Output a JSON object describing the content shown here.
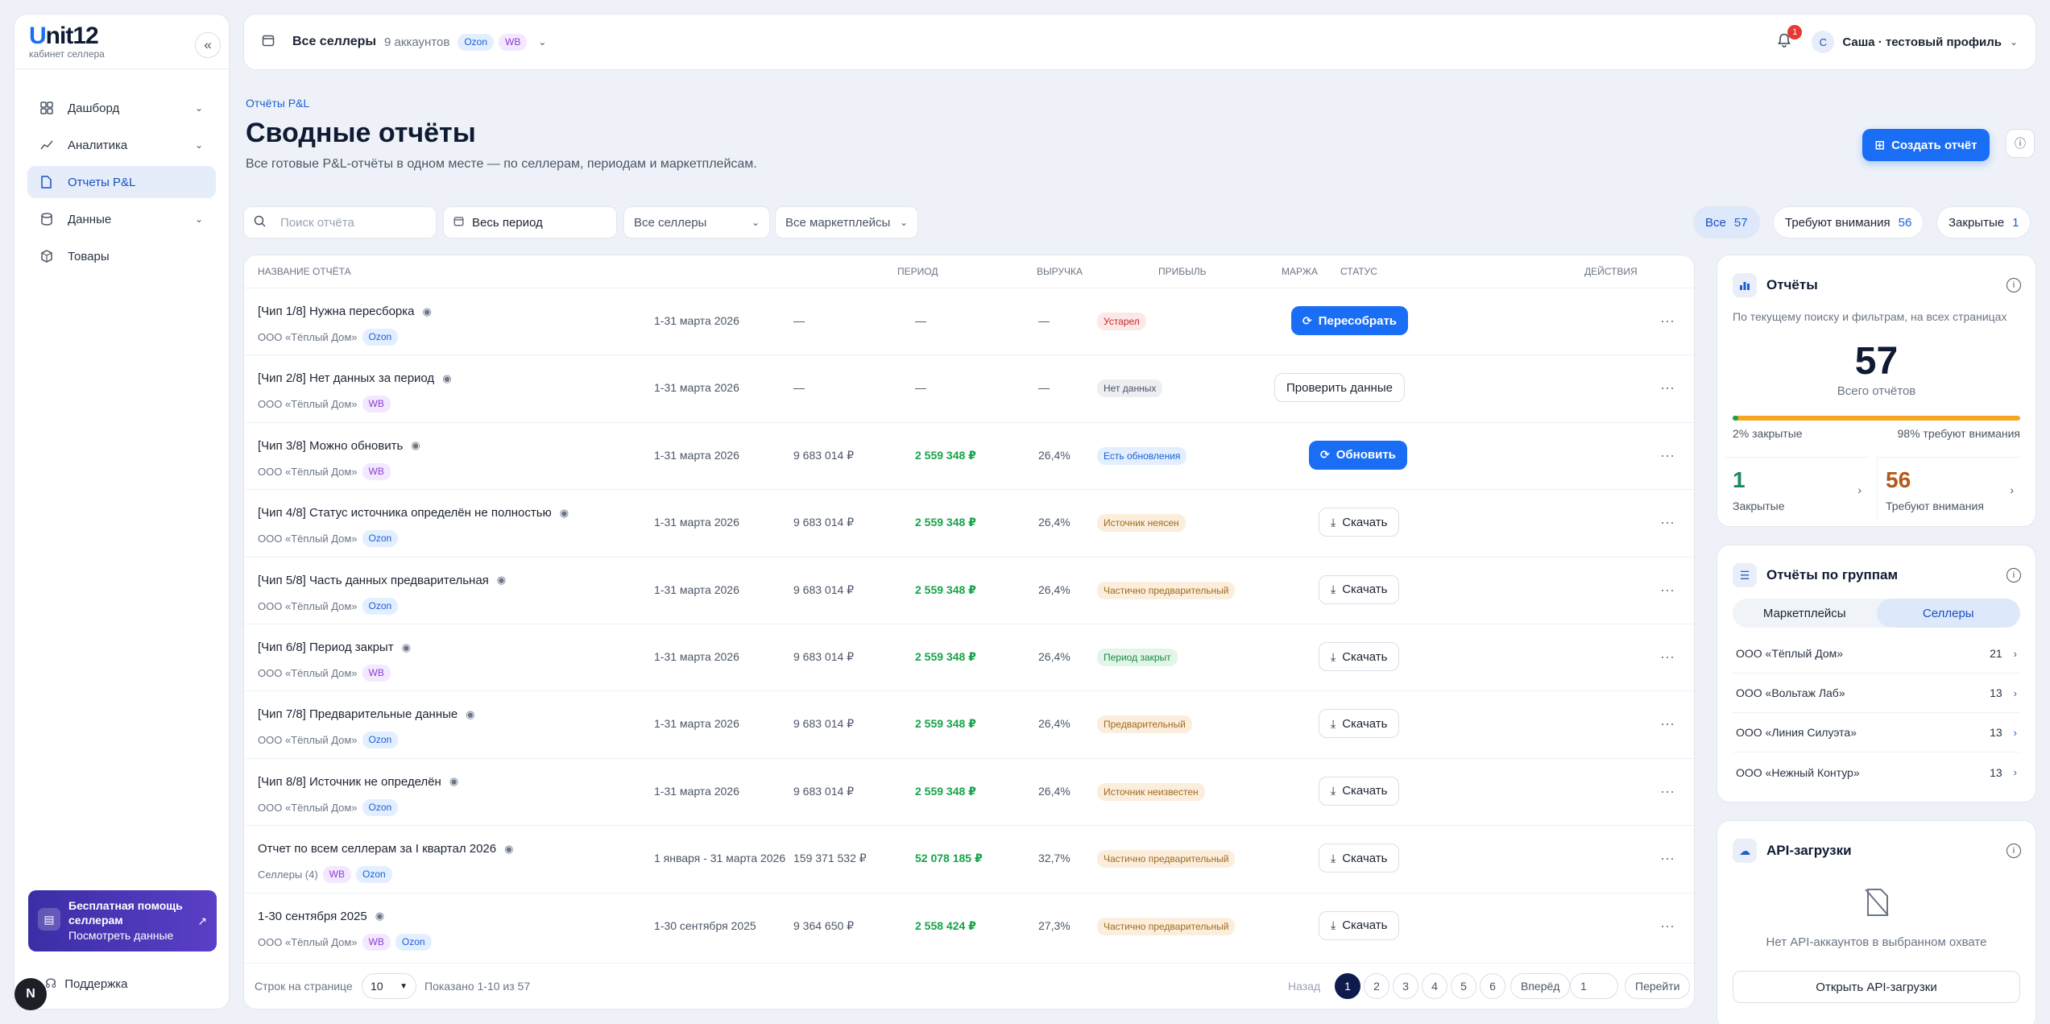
{
  "sidebar": {
    "brand_prefix": "U",
    "brand_rest": "nit12",
    "brand_sub": "кабинет селлера",
    "collapse_icon": "chevrons-left-icon",
    "items": [
      {
        "label": "Дашборд",
        "icon": "grid-icon",
        "has_chevron": true
      },
      {
        "label": "Аналитика",
        "icon": "chart-line-icon",
        "has_chevron": true
      },
      {
        "label": "Отчеты P&L",
        "icon": "file-icon",
        "active": true
      },
      {
        "label": "Данные",
        "icon": "database-icon",
        "has_chevron": true
      },
      {
        "label": "Товары",
        "icon": "box-icon"
      }
    ],
    "promo_title": "Бесплатная помощь селлерам",
    "promo_link": "Посмотреть данные",
    "support": "Поддержка",
    "avatar_letter": "N"
  },
  "header": {
    "sellers_label": "Все селлеры",
    "accounts_count": "9 аккаунтов",
    "tag_ozon": "Ozon",
    "tag_wb": "WB",
    "notification_count": "1",
    "user_initial": "С",
    "user_name": "Саша · тестовый профиль"
  },
  "page": {
    "breadcrumb": "Отчёты P&L",
    "title": "Сводные отчёты",
    "subtitle": "Все готовые P&L-отчёты в одном месте — по селлерам, периодам и маркетплейсам.",
    "create_button": "Создать отчёт"
  },
  "filters": {
    "search_placeholder": "Поиск отчёта",
    "period": "Весь период",
    "sellers": "Все селлеры",
    "marketplaces": "Все маркетплейсы",
    "segments": [
      {
        "label": "Все",
        "count": "57",
        "active": true
      },
      {
        "label": "Требуют внимания",
        "count": "56"
      },
      {
        "label": "Закрытые",
        "count": "1"
      }
    ]
  },
  "table": {
    "headers": {
      "name": "Название отчёта",
      "period": "Период",
      "revenue": "Выручка",
      "profit": "Прибыль",
      "margin": "Маржа",
      "status": "Статус",
      "actions": "Действия"
    },
    "rows": [
      {
        "name": "[Чип 1/8] Нужна пересборка",
        "seller": "ООО «Тёплый Дом»",
        "tags": [
          "Ozon"
        ],
        "period": "1-31 марта 2026",
        "revenue": "—",
        "profit": "—",
        "margin": "—",
        "status": "Устарел",
        "status_color": "red",
        "action": "Пересобрать",
        "action_icon": "refresh-icon",
        "action_style": "primary"
      },
      {
        "name": "[Чип 2/8] Нет данных за период",
        "seller": "ООО «Тёплый Дом»",
        "tags": [
          "WB"
        ],
        "period": "1-31 марта 2026",
        "revenue": "—",
        "profit": "—",
        "margin": "—",
        "status": "Нет данных",
        "status_color": "gray",
        "action": "Проверить данные",
        "action_icon": "",
        "action_style": "outline"
      },
      {
        "name": "[Чип 3/8] Можно обновить",
        "seller": "ООО «Тёплый Дом»",
        "tags": [
          "WB"
        ],
        "period": "1-31 марта 2026",
        "revenue": "9 683 014 ₽",
        "profit": "2 559 348 ₽",
        "margin": "26,4%",
        "status": "Есть обновления",
        "status_color": "blue",
        "action": "Обновить",
        "action_icon": "refresh-icon",
        "action_style": "primary"
      },
      {
        "name": "[Чип 4/8] Статус источника определён не полностью",
        "seller": "ООО «Тёплый Дом»",
        "tags": [
          "Ozon"
        ],
        "period": "1-31 марта 2026",
        "revenue": "9 683 014 ₽",
        "profit": "2 559 348 ₽",
        "margin": "26,4%",
        "status": "Источник неясен",
        "status_color": "yellow",
        "action": "Скачать",
        "action_icon": "download-icon",
        "action_style": "outline"
      },
      {
        "name": "[Чип 5/8] Часть данных предварительная",
        "seller": "ООО «Тёплый Дом»",
        "tags": [
          "Ozon"
        ],
        "period": "1-31 марта 2026",
        "revenue": "9 683 014 ₽",
        "profit": "2 559 348 ₽",
        "margin": "26,4%",
        "status": "Частично предварительный",
        "status_color": "yellow",
        "action": "Скачать",
        "action_icon": "download-icon",
        "action_style": "outline"
      },
      {
        "name": "[Чип 6/8] Период закрыт",
        "seller": "ООО «Тёплый Дом»",
        "tags": [
          "WB"
        ],
        "period": "1-31 марта 2026",
        "revenue": "9 683 014 ₽",
        "profit": "2 559 348 ₽",
        "margin": "26,4%",
        "status": "Период закрыт",
        "status_color": "green",
        "action": "Скачать",
        "action_icon": "download-icon",
        "action_style": "outline"
      },
      {
        "name": "[Чип 7/8] Предварительные данные",
        "seller": "ООО «Тёплый Дом»",
        "tags": [
          "Ozon"
        ],
        "period": "1-31 марта 2026",
        "revenue": "9 683 014 ₽",
        "profit": "2 559 348 ₽",
        "margin": "26,4%",
        "status": "Предварительный",
        "status_color": "yellow",
        "action": "Скачать",
        "action_icon": "download-icon",
        "action_style": "outline"
      },
      {
        "name": "[Чип 8/8] Источник не определён",
        "seller": "ООО «Тёплый Дом»",
        "tags": [
          "Ozon"
        ],
        "period": "1-31 марта 2026",
        "revenue": "9 683 014 ₽",
        "profit": "2 559 348 ₽",
        "margin": "26,4%",
        "status": "Источник неизвестен",
        "status_color": "yellow",
        "action": "Скачать",
        "action_icon": "download-icon",
        "action_style": "outline"
      },
      {
        "name": "Отчет по всем селлерам за I квартал 2026",
        "seller": "Селлеры (4)",
        "tags": [
          "WB",
          "Ozon"
        ],
        "period": "1 января - 31 марта 2026",
        "revenue": "159 371 532 ₽",
        "profit": "52 078 185 ₽",
        "margin": "32,7%",
        "status": "Частично предварительный",
        "status_color": "yellow",
        "action": "Скачать",
        "action_icon": "download-icon",
        "action_style": "outline"
      },
      {
        "name": "1-30 сентября 2025",
        "seller": "ООО «Тёплый Дом»",
        "tags": [
          "WB",
          "Ozon"
        ],
        "period": "1-30 сентября 2025",
        "revenue": "9 364 650 ₽",
        "profit": "2 558 424 ₽",
        "margin": "27,3%",
        "status": "Частично предварительный",
        "status_color": "yellow",
        "action": "Скачать",
        "action_icon": "download-icon",
        "action_style": "outline"
      }
    ],
    "footer": {
      "rows_per_page_label": "Строк на странице",
      "rows_per_page_value": "10",
      "shown": "Показано 1-10 из 57",
      "prev": "Назад",
      "pages": [
        "1",
        "2",
        "3",
        "4",
        "5",
        "6"
      ],
      "current_page": "1",
      "next": "Вперёд",
      "goto_value": "1",
      "goto_button": "Перейти"
    }
  },
  "reports_panel": {
    "title": "Отчёты",
    "description": "По текущему поиску и фильтрам, на всех страницах",
    "total": "57",
    "total_label": "Всего отчётов",
    "closed_fraction": 0.02,
    "closed_pct_label": "2% закрытые",
    "attention_pct_label": "98% требуют внимания",
    "closed_count": "1",
    "closed_label": "Закрытые",
    "attention_count": "56",
    "attention_label": "Требуют внимания"
  },
  "groups_panel": {
    "title": "Отчёты по группам",
    "tabs": [
      "Маркетплейсы",
      "Селлеры"
    ],
    "active_tab": "Селлеры",
    "items": [
      {
        "name": "ООО «Тёплый Дом»",
        "count": "21"
      },
      {
        "name": "ООО «Вольтаж Лаб»",
        "count": "13"
      },
      {
        "name": "ООО «Линия Силуэта»",
        "count": "13"
      },
      {
        "name": "ООО «Нежный Контур»",
        "count": "13"
      }
    ]
  },
  "api_panel": {
    "title": "API-загрузки",
    "empty_text": "Нет API-аккаунтов в выбранном охвате",
    "button": "Открыть API-загрузки"
  },
  "colors": {
    "accent": "#1a6ef5",
    "profit": "#17a34a",
    "attention": "#b5581a",
    "closed": "#1a8a5c"
  }
}
